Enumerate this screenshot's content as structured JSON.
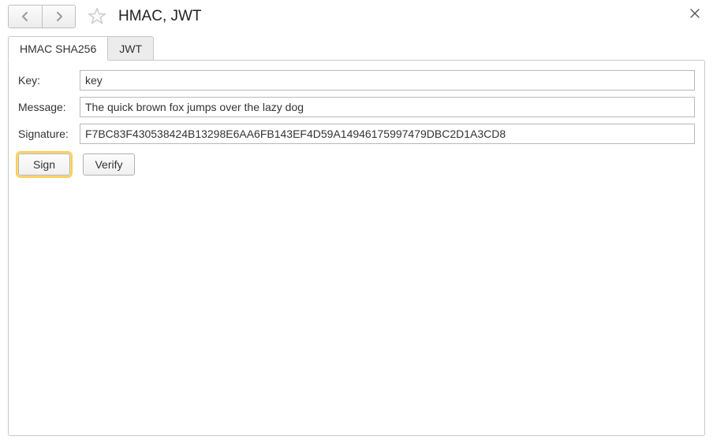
{
  "header": {
    "title": "HMAC, JWT"
  },
  "tabs": [
    {
      "label": "HMAC SHA256",
      "active": true
    },
    {
      "label": "JWT",
      "active": false
    }
  ],
  "form": {
    "key_label": "Key:",
    "key_value": "key",
    "message_label": "Message:",
    "message_value": "The quick brown fox jumps over the lazy dog",
    "signature_label": "Signature:",
    "signature_value": "F7BC83F430538424B13298E6AA6FB143EF4D59A14946175997479DBC2D1A3CD8"
  },
  "buttons": {
    "sign": "Sign",
    "verify": "Verify"
  }
}
